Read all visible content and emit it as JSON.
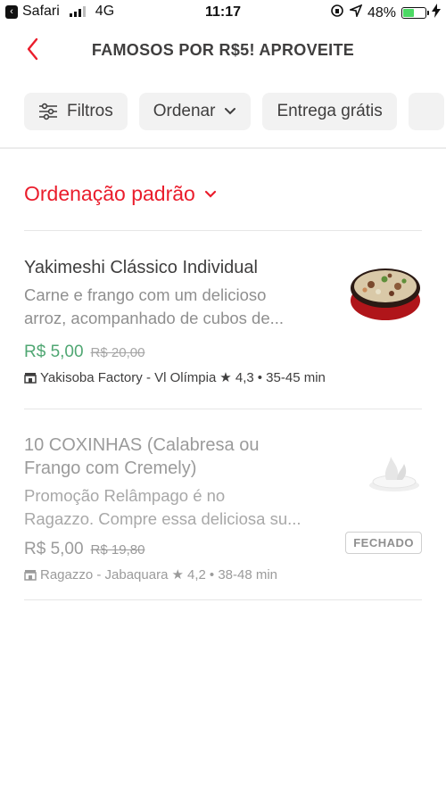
{
  "status_bar": {
    "back_app": "Safari",
    "network": "4G",
    "time": "11:17",
    "battery": "48%",
    "battery_level": 0.48,
    "accent": "#4cd964"
  },
  "nav": {
    "title": "FAMOSOS POR R$5! APROVEITE",
    "back_icon": "chevron-left-icon"
  },
  "filters": [
    {
      "label": "Filtros",
      "icon": "sliders-icon"
    },
    {
      "label": "Ordenar",
      "icon": "chevron-down-icon"
    },
    {
      "label": "Entrega grátis"
    }
  ],
  "sort": {
    "label": "Ordenação padrão",
    "color": "#ea1d2c"
  },
  "items": [
    {
      "name": "Yakimeshi Clássico Individual",
      "desc_line1": "Carne e frango com um delicioso",
      "desc_line2": "arroz, acompanhado de cubos de...",
      "price": "R$  5,00",
      "old_price": "R$  20,00",
      "store": "Yakisoba Factory - Vl Olímpia",
      "rating": "★ 4,3",
      "time": "• 35-45 min",
      "price_color": "#50a773"
    },
    {
      "name_line1": "10 COXINHAS (Calabresa ou",
      "name_line2": "Frango com Cremely)",
      "desc_line1": "Promoção Relâmpago é no",
      "desc_line2": "Ragazzo. Compre essa deliciosa su...",
      "price": "R$  5,00",
      "old_price": "R$  19,80",
      "store": "Ragazzo - Jabaquara",
      "rating": "★ 4,2",
      "time": "• 38-48 min",
      "badge": "FECHADO"
    }
  ]
}
